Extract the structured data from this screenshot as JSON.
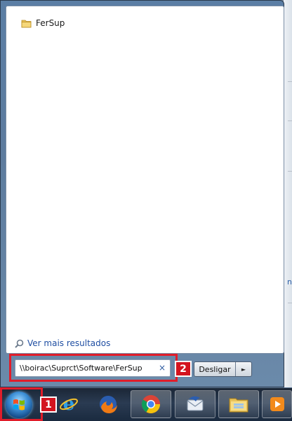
{
  "results": {
    "items": [
      {
        "label": "FerSup",
        "icon": "folder-icon"
      }
    ],
    "see_more_label": "Ver mais resultados"
  },
  "search": {
    "value": "\\\\boirac\\Suprct\\Software\\FerSup",
    "clear_glyph": "×"
  },
  "shutdown": {
    "label": "Desligar",
    "arrow_glyph": "►"
  },
  "annotations": {
    "badge_1": "1",
    "badge_2": "2",
    "highlight_color": "#e11d2a"
  },
  "taskbar": {
    "pinned": [
      {
        "icon": "internet-explorer-icon"
      },
      {
        "icon": "firefox-icon"
      },
      {
        "icon": "chrome-icon"
      },
      {
        "icon": "thunderbird-icon"
      },
      {
        "icon": "windows-explorer-icon"
      },
      {
        "icon": "media-player-icon"
      }
    ]
  }
}
